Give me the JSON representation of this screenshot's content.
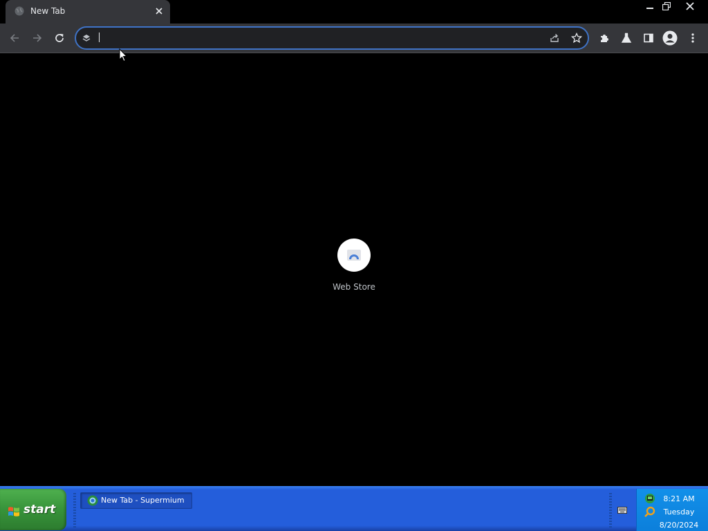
{
  "browser": {
    "tab": {
      "title": "New Tab"
    },
    "omnibox": {
      "value": "",
      "placeholder": ""
    },
    "accent_color": "#3f73c7"
  },
  "newtab": {
    "shortcuts": [
      {
        "label": "Web Store"
      }
    ]
  },
  "taskbar": {
    "start_label": "start",
    "tasks": [
      {
        "label": "New Tab - Supermium"
      }
    ],
    "clock": {
      "time": "8:21 AM",
      "day": "Tuesday",
      "date": "8/20/2024"
    }
  },
  "colors": {
    "taskbar_blue": "#245edb",
    "start_green": "#37933a",
    "tray_blue": "#0c7fdb",
    "toolbar_bg": "#35363a"
  },
  "icons": [
    "globe-icon",
    "close-icon",
    "minimize-icon",
    "restore-icon",
    "back-arrow-icon",
    "forward-arrow-icon",
    "reload-icon",
    "site-info-icon",
    "share-icon",
    "bookmark-star-icon",
    "extensions-puzzle-icon",
    "labs-flask-icon",
    "side-panel-icon",
    "profile-avatar-icon",
    "kebab-menu-icon",
    "web-store-icon",
    "windows-flag-icon",
    "keyboard-icon",
    "network-icon",
    "search-icon"
  ]
}
